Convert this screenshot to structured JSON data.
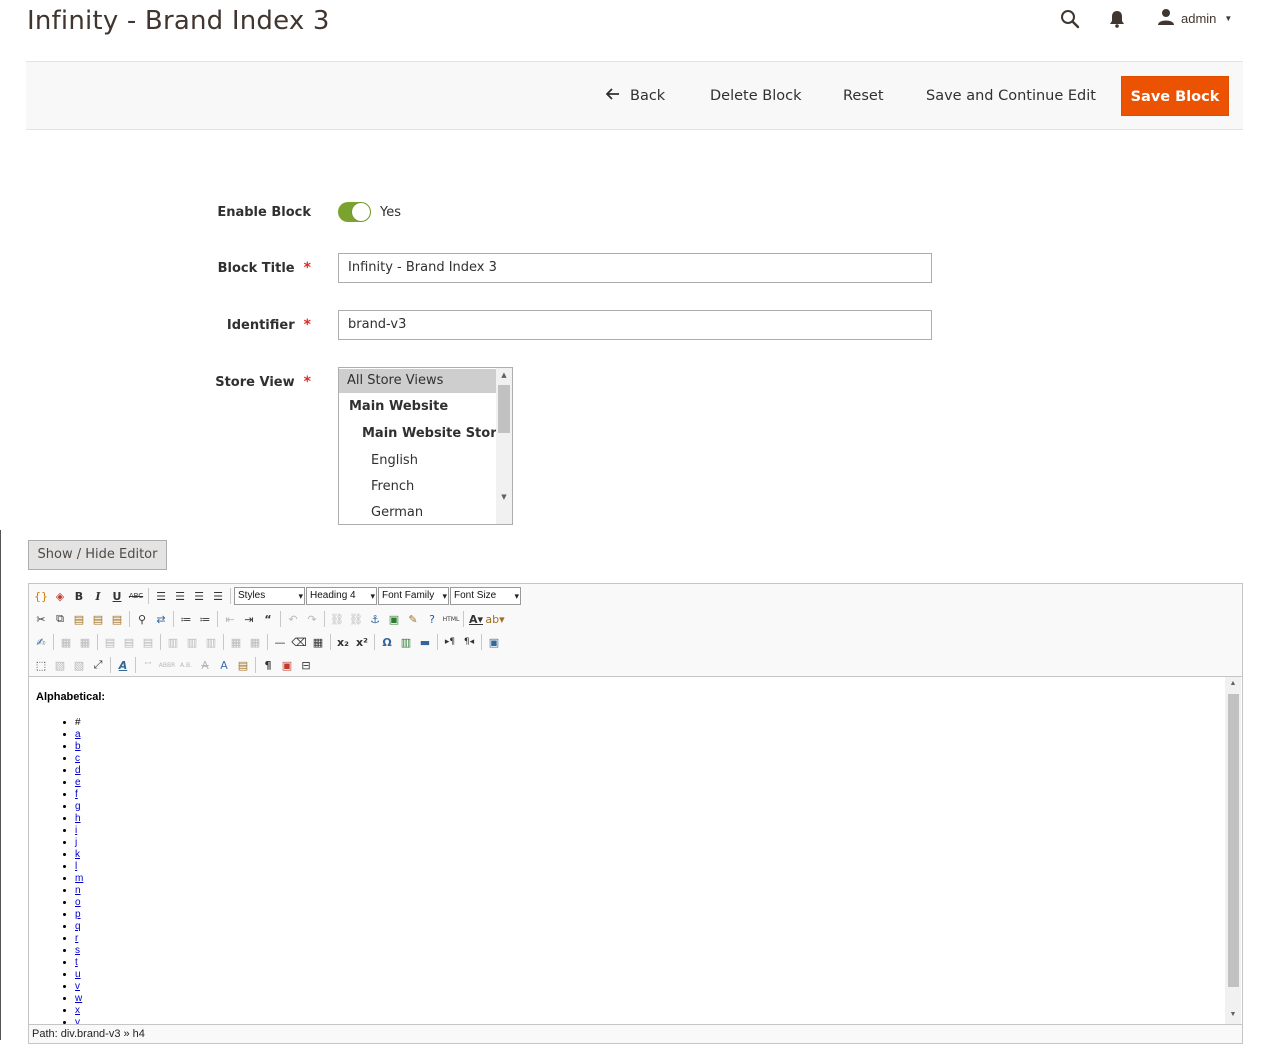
{
  "header": {
    "title": "Infinity - Brand Index 3",
    "user": "admin"
  },
  "actions": {
    "back": "Back",
    "delete": "Delete Block",
    "reset": "Reset",
    "save_continue": "Save and Continue Edit",
    "save": "Save Block"
  },
  "form": {
    "enable_label": "Enable Block",
    "enable_value": "Yes",
    "title_label": "Block Title",
    "title_value": "Infinity - Brand Index 3",
    "identifier_label": "Identifier",
    "identifier_value": "brand-v3",
    "store_label": "Store View",
    "required_mark": "*",
    "store_options": [
      "All Store Views",
      "Main Website",
      "Main Website Store",
      "English",
      "French",
      "German"
    ],
    "store_selected": "All Store Views"
  },
  "editor": {
    "toggle_label": "Show / Hide Editor",
    "styles": "Styles",
    "format": "Heading 4",
    "font_family": "Font Family",
    "font_size": "Font Size",
    "heading": "Alphabetical:",
    "letters": [
      "#",
      "a",
      "b",
      "c",
      "d",
      "e",
      "f",
      "g",
      "h",
      "i",
      "j",
      "k",
      "l",
      "m",
      "n",
      "o",
      "p",
      "q",
      "r",
      "s",
      "t",
      "u",
      "v",
      "w",
      "x",
      "y"
    ],
    "path": "Path: div.brand-v3 » h4"
  },
  "colors": {
    "accent": "#eb5202",
    "toggle_on": "#79a22e",
    "required": "#e22626"
  }
}
